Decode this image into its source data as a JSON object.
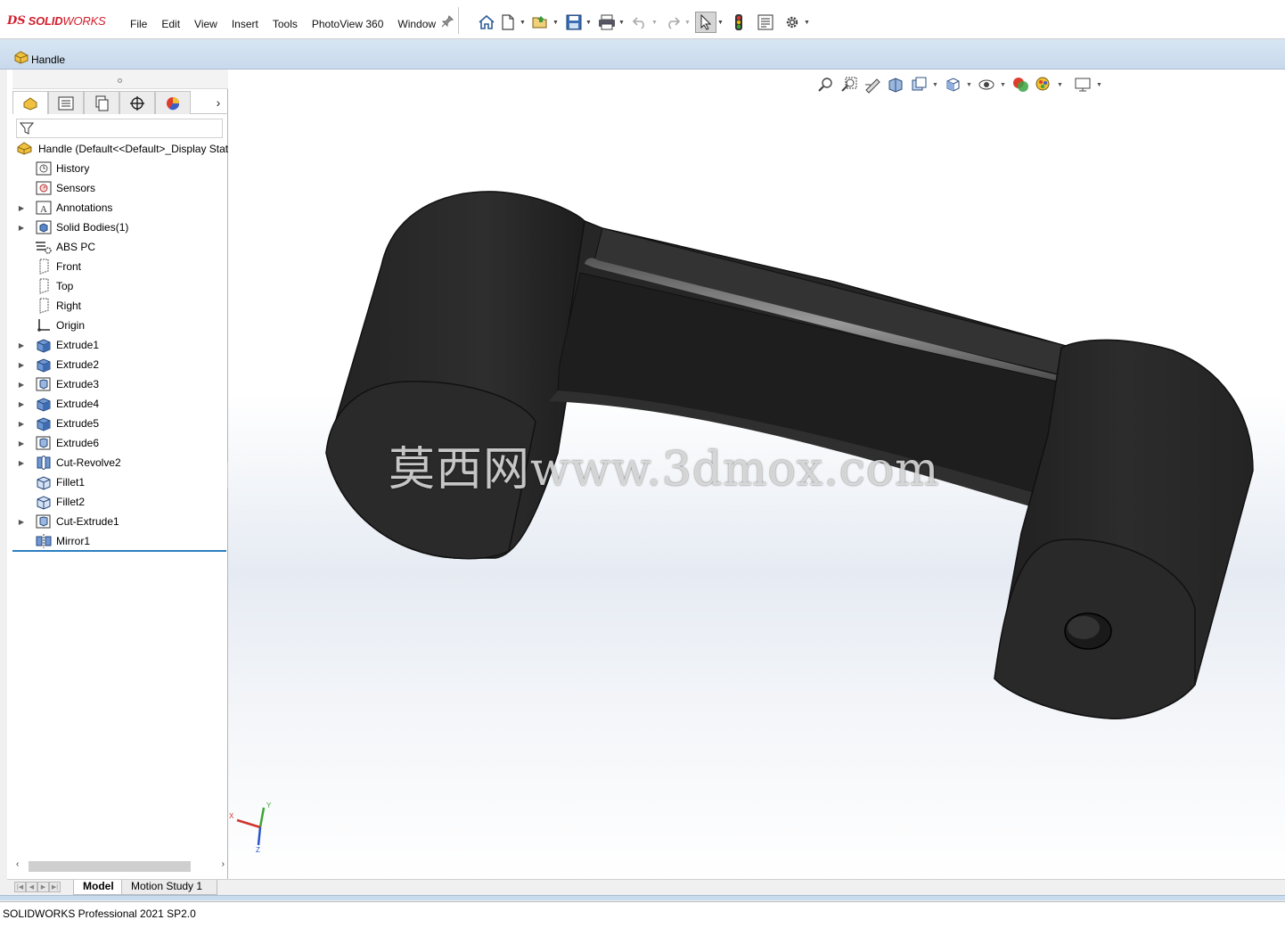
{
  "app": {
    "logo_ds": "DS",
    "logo_name_bold": "SOLID",
    "logo_name_rest": "WORKS"
  },
  "menu": [
    "File",
    "Edit",
    "View",
    "Insert",
    "Tools",
    "PhotoView 360",
    "Window"
  ],
  "document": {
    "title": "Handle"
  },
  "feature_tree": {
    "root_label": "Handle  (Default<<Default>_Display Stat",
    "items": [
      {
        "label": "History",
        "expandable": false,
        "icon": "history-icon"
      },
      {
        "label": "Sensors",
        "expandable": false,
        "icon": "sensors-icon"
      },
      {
        "label": "Annotations",
        "expandable": true,
        "icon": "annotations-icon"
      },
      {
        "label": "Solid Bodies(1)",
        "expandable": true,
        "icon": "solid-bodies-icon"
      },
      {
        "label": "ABS PC",
        "expandable": false,
        "icon": "material-icon"
      },
      {
        "label": "Front",
        "expandable": false,
        "icon": "plane-icon"
      },
      {
        "label": "Top",
        "expandable": false,
        "icon": "plane-icon"
      },
      {
        "label": "Right",
        "expandable": false,
        "icon": "plane-icon"
      },
      {
        "label": "Origin",
        "expandable": false,
        "icon": "origin-icon"
      },
      {
        "label": "Extrude1",
        "expandable": true,
        "icon": "extrude-icon"
      },
      {
        "label": "Extrude2",
        "expandable": true,
        "icon": "extrude-icon"
      },
      {
        "label": "Extrude3",
        "expandable": true,
        "icon": "cut-extrude-icon"
      },
      {
        "label": "Extrude4",
        "expandable": true,
        "icon": "extrude-icon"
      },
      {
        "label": "Extrude5",
        "expandable": true,
        "icon": "extrude-icon"
      },
      {
        "label": "Extrude6",
        "expandable": true,
        "icon": "cut-extrude-icon"
      },
      {
        "label": "Cut-Revolve2",
        "expandable": true,
        "icon": "cut-revolve-icon"
      },
      {
        "label": "Fillet1",
        "expandable": false,
        "icon": "fillet-icon"
      },
      {
        "label": "Fillet2",
        "expandable": false,
        "icon": "fillet-icon"
      },
      {
        "label": "Cut-Extrude1",
        "expandable": true,
        "icon": "cut-extrude-icon"
      },
      {
        "label": "Mirror1",
        "expandable": false,
        "icon": "mirror-icon"
      }
    ]
  },
  "viewport": {
    "watermark": "莫西网www.3dmox.com",
    "triad": {
      "x": "X",
      "y": "Y",
      "z": "Z"
    },
    "x_color": "#d0342c",
    "y_color": "#3fa535",
    "z_color": "#2a55c9"
  },
  "bottom_tabs": {
    "model": "Model",
    "motion": "Motion Study 1"
  },
  "status": {
    "text": "SOLIDWORKS Professional 2021 SP2.0"
  },
  "colors": {
    "accent": "#2b7ec1",
    "model_body": "#2a2a2a"
  }
}
